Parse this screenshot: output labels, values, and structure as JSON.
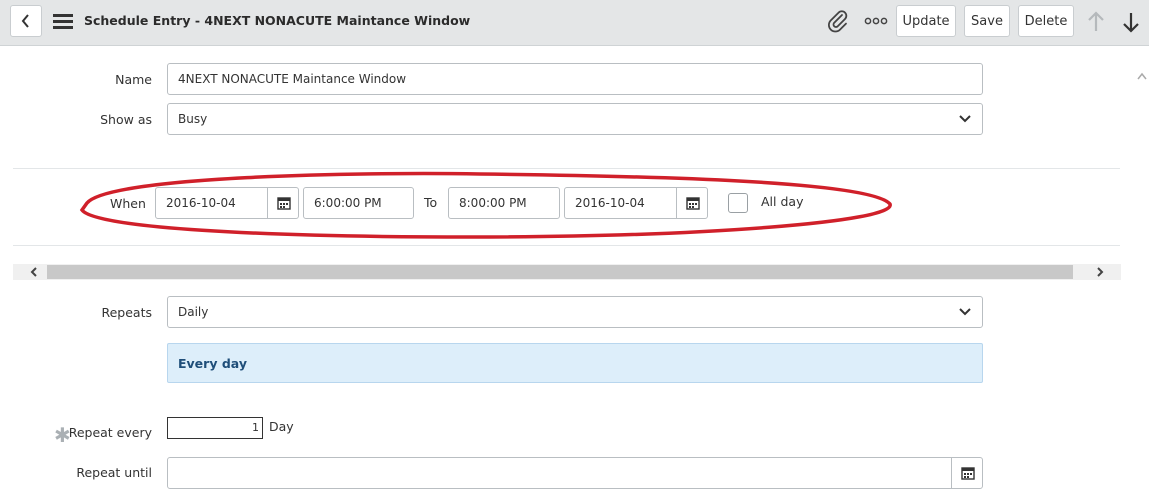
{
  "header": {
    "title": "Schedule Entry - 4NEXT NONACUTE Maintance Window",
    "back_icon": "chevron-left-icon",
    "menu_icon": "hamburger-menu-icon",
    "attach_icon": "paperclip-icon",
    "more_icon": "more-options-icon",
    "update_label": "Update",
    "save_label": "Save",
    "delete_label": "Delete",
    "prev_icon": "arrow-up-icon",
    "next_icon": "arrow-down-icon"
  },
  "form": {
    "name_label": "Name",
    "name_value": "4NEXT NONACUTE Maintance Window",
    "show_as_label": "Show as",
    "show_as_value": "Busy",
    "when_label": "When",
    "start_date": "2016-10-04",
    "start_time": "6:00:00 PM",
    "to_label": "To",
    "end_time": "8:00:00 PM",
    "end_date": "2016-10-04",
    "all_day_label": "All day",
    "all_day_checked": false,
    "repeats_label": "Repeats",
    "repeats_value": "Daily",
    "repeat_summary": "Every day",
    "repeat_every_label": "Repeat every",
    "repeat_every_value": "1",
    "repeat_every_unit": "Day",
    "repeat_until_label": "Repeat until",
    "repeat_until_value": ""
  },
  "colors": {
    "header_bg": "#e4e6e7",
    "highlight_ellipse": "#d0202a",
    "info_box_bg": "#ddeefa",
    "info_box_text": "#1f4e79"
  }
}
